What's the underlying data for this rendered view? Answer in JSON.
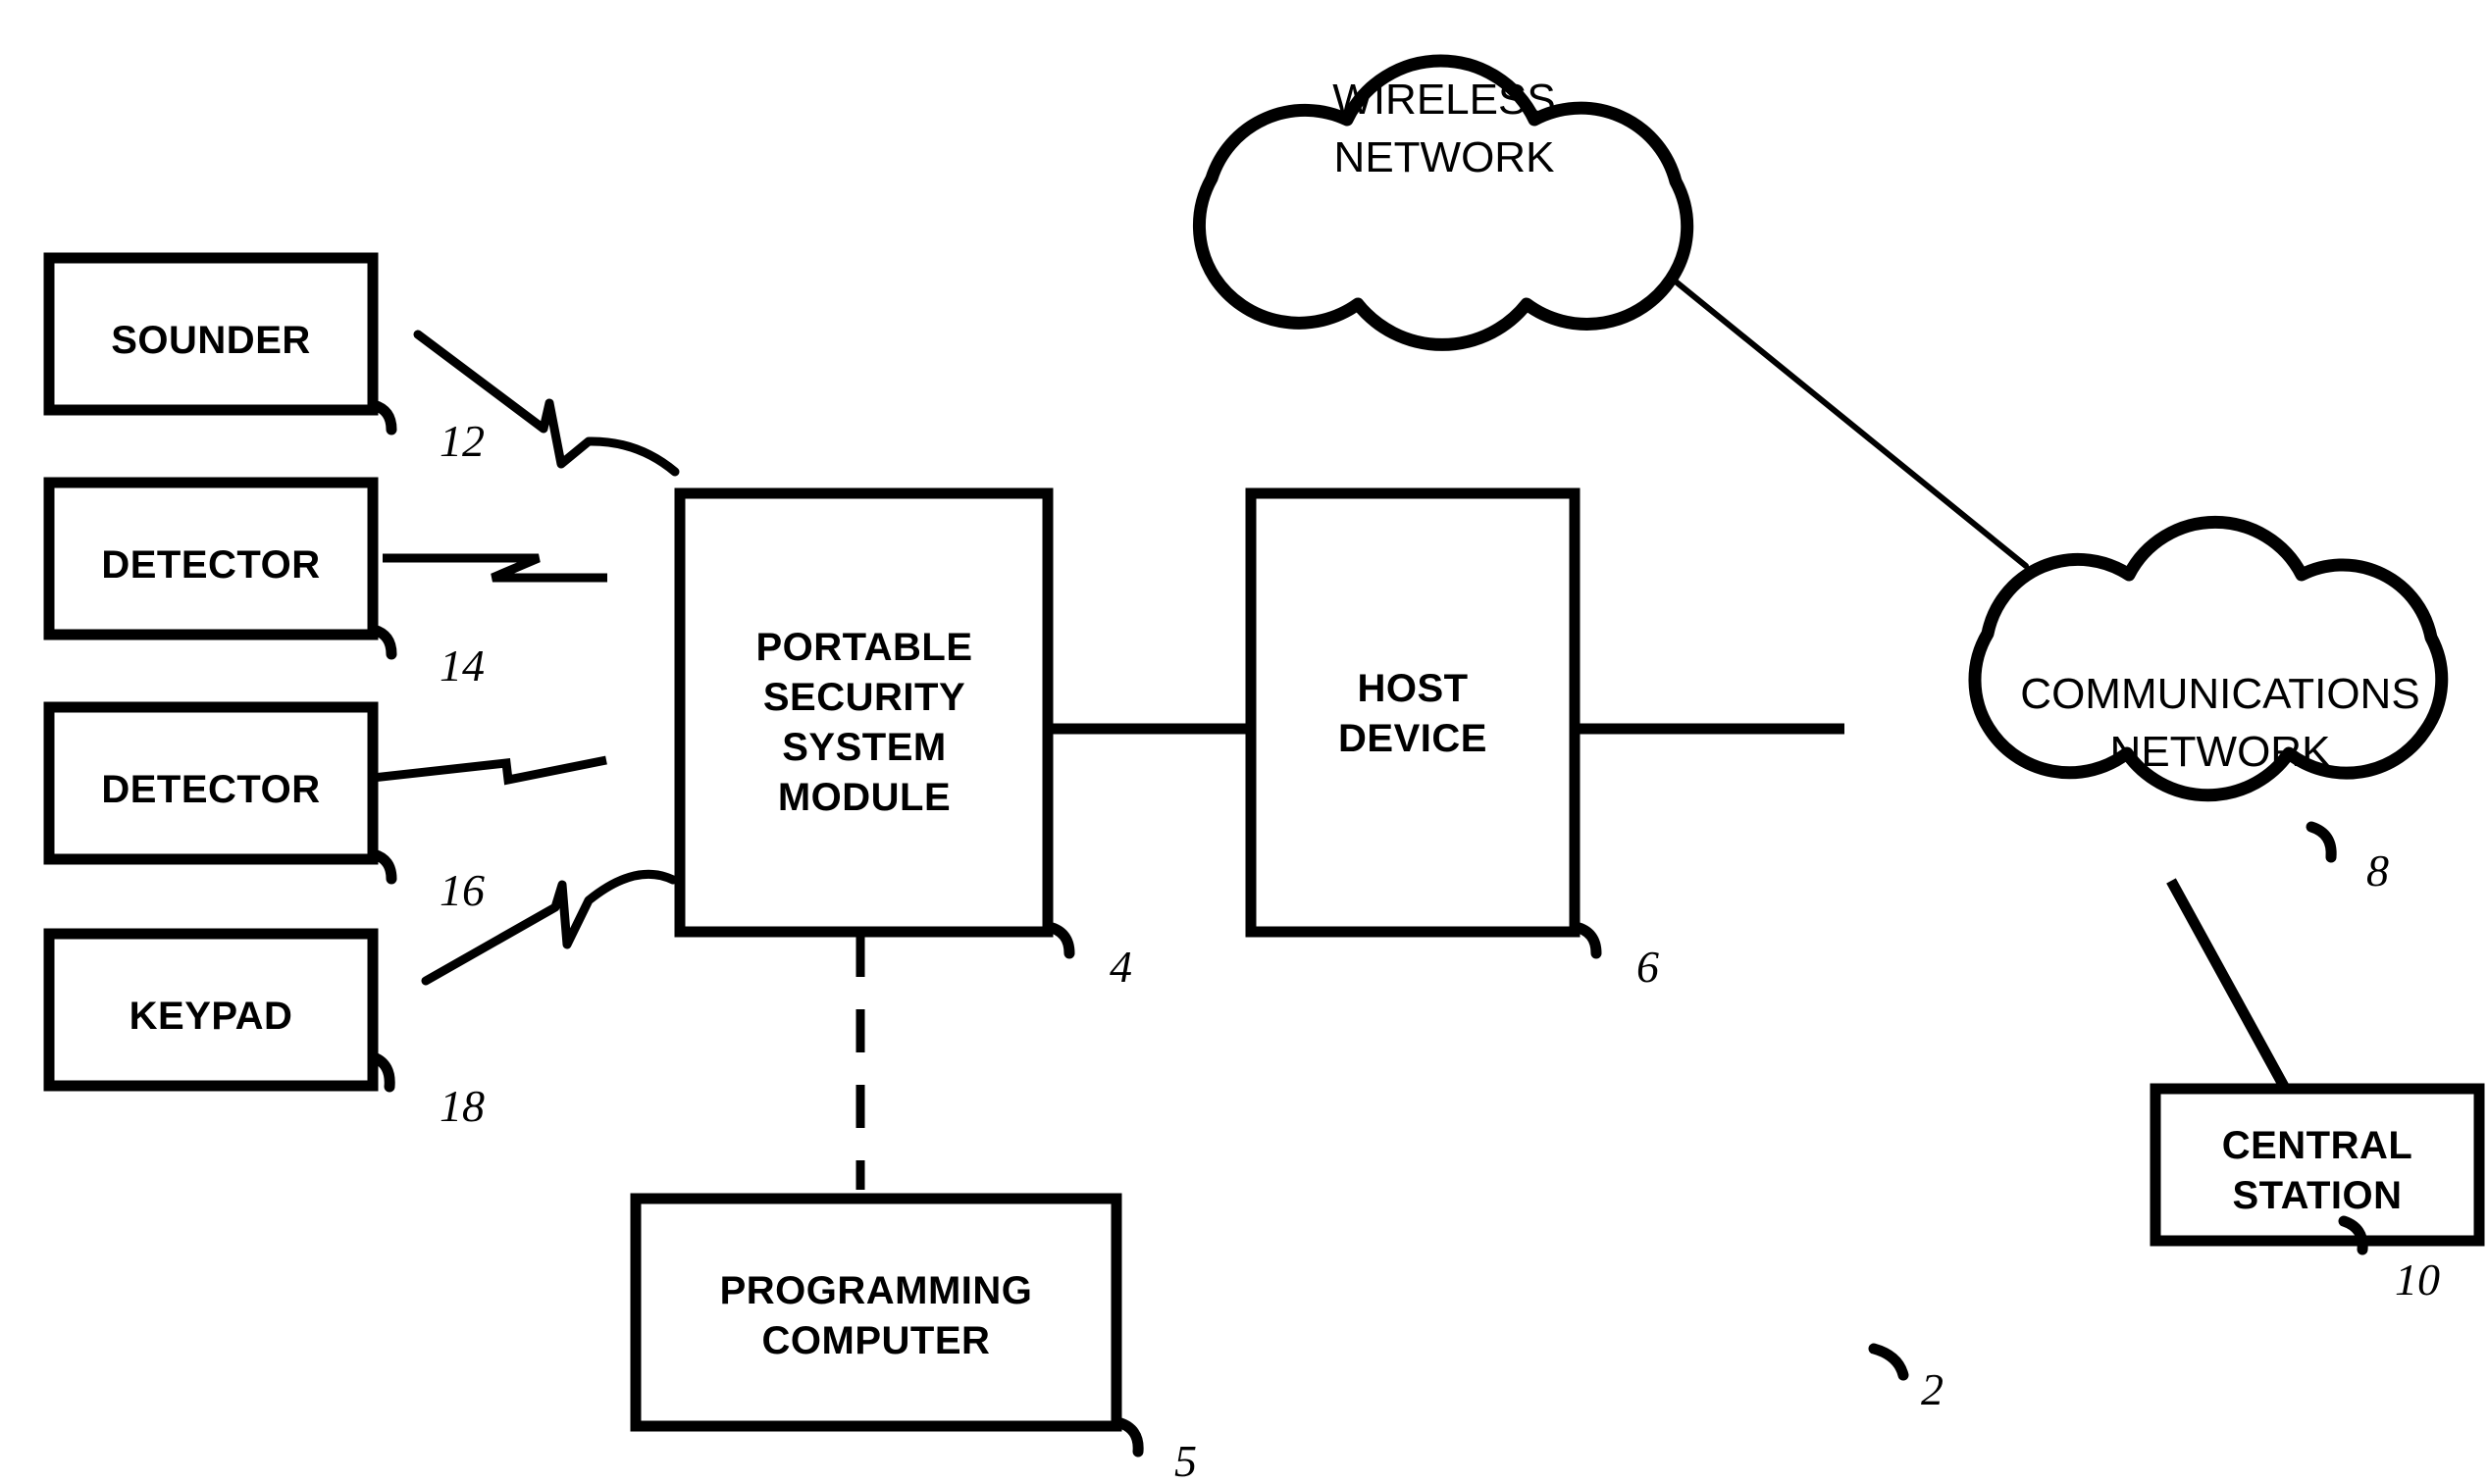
{
  "figure": {
    "type": "patent-block-diagram",
    "background_color": "#ffffff",
    "line_color": "#000000"
  },
  "boxes": {
    "sounder": {
      "label": "SOUNDER",
      "ref": "12"
    },
    "detector_top": {
      "label": "DETECTOR",
      "ref": "14"
    },
    "detector_bottom": {
      "label": "DETECTOR",
      "ref": "16"
    },
    "keypad": {
      "label": "KEYPAD",
      "ref": "18"
    },
    "module": {
      "line1": "PORTABLE",
      "line2": "SECURITY",
      "line3": "SYSTEM",
      "line4": "MODULE",
      "ref": "4"
    },
    "host_device": {
      "line1": "HOST",
      "line2": "DEVICE",
      "ref": "6"
    },
    "programming_computer": {
      "line1": "PROGRAMMING",
      "line2": "COMPUTER",
      "ref": "5"
    },
    "central_station": {
      "line1": "CENTRAL",
      "line2": "STATION",
      "ref": "10"
    }
  },
  "clouds": {
    "wireless_network": {
      "line1": "WIRELESS",
      "line2": "NETWORK"
    },
    "communications_network": {
      "line1": "COMMUNICATIONS",
      "line2": "NETWORK"
    }
  },
  "figure_reference": {
    "ref": "2"
  },
  "reference_numbers": [
    "2",
    "4",
    "5",
    "6",
    "8",
    "10",
    "12",
    "14",
    "16",
    "18"
  ]
}
